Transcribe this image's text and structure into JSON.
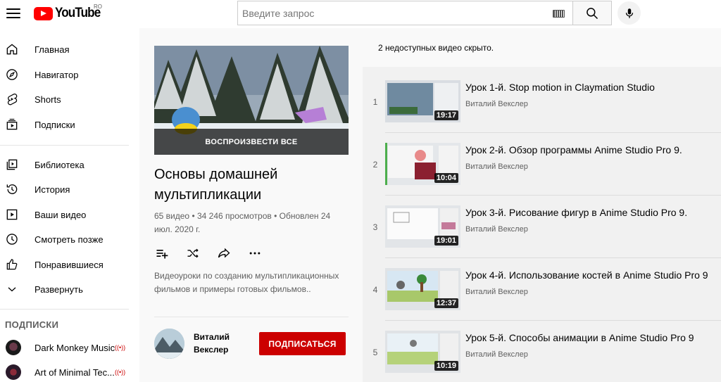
{
  "header": {
    "logo_text": "YouTube",
    "region": "RO",
    "search_placeholder": "Введите запрос"
  },
  "sidebar": {
    "items": [
      {
        "label": "Главная",
        "icon": "home-icon"
      },
      {
        "label": "Навигатор",
        "icon": "compass-icon"
      },
      {
        "label": "Shorts",
        "icon": "shorts-icon"
      },
      {
        "label": "Подписки",
        "icon": "subscriptions-icon"
      },
      {
        "label": "Библиотека",
        "icon": "library-icon"
      },
      {
        "label": "История",
        "icon": "history-icon"
      },
      {
        "label": "Ваши видео",
        "icon": "your-videos-icon"
      },
      {
        "label": "Смотреть позже",
        "icon": "watch-later-icon"
      },
      {
        "label": "Понравившиеся",
        "icon": "thumbs-up-icon"
      },
      {
        "label": "Развернуть",
        "icon": "chevron-down-icon"
      }
    ],
    "subscriptions_heading": "ПОДПИСКИ",
    "subscriptions": [
      {
        "label": "Dark Monkey Music"
      },
      {
        "label": "Art of Minimal Tec..."
      }
    ]
  },
  "playlist": {
    "play_all": "ВОСПРОИЗВЕСТИ ВСЕ",
    "title": "Основы домашней мультипликации",
    "stats": "65 видео • 34 246 просмотров • Обновлен 24 июл. 2020 г.",
    "description": "Видеоуроки по созданию мультипликационных фильмов и примеры готовых фильмов..",
    "owner_name": "Виталий Векслер",
    "subscribe_label": "ПОДПИСАТЬСЯ"
  },
  "list": {
    "hidden_note": "2 недоступных видео скрыто.",
    "videos": [
      {
        "index": "1",
        "title": "Урок 1-й. Stop motion in Claymation Studio",
        "channel": "Виталий Векслер",
        "duration": "19:17"
      },
      {
        "index": "2",
        "title": "Урок 2-й. Обзор программы Anime Studio Pro 9.",
        "channel": "Виталий Векслер",
        "duration": "10:04"
      },
      {
        "index": "3",
        "title": "Урок 3-й. Рисование фигур в Anime Studio Pro 9.",
        "channel": "Виталий Векслер",
        "duration": "19:01"
      },
      {
        "index": "4",
        "title": "Урок 4-й. Использование костей в Anime Studio Pro 9",
        "channel": "Виталий Векслер",
        "duration": "12:37"
      },
      {
        "index": "5",
        "title": "Урок 5-й. Способы анимации в Anime Studio Pro 9",
        "channel": "Виталий Векслер",
        "duration": "10:19"
      }
    ]
  },
  "colors": {
    "brand_red": "#ff0000",
    "subscribe_red": "#cc0000"
  }
}
